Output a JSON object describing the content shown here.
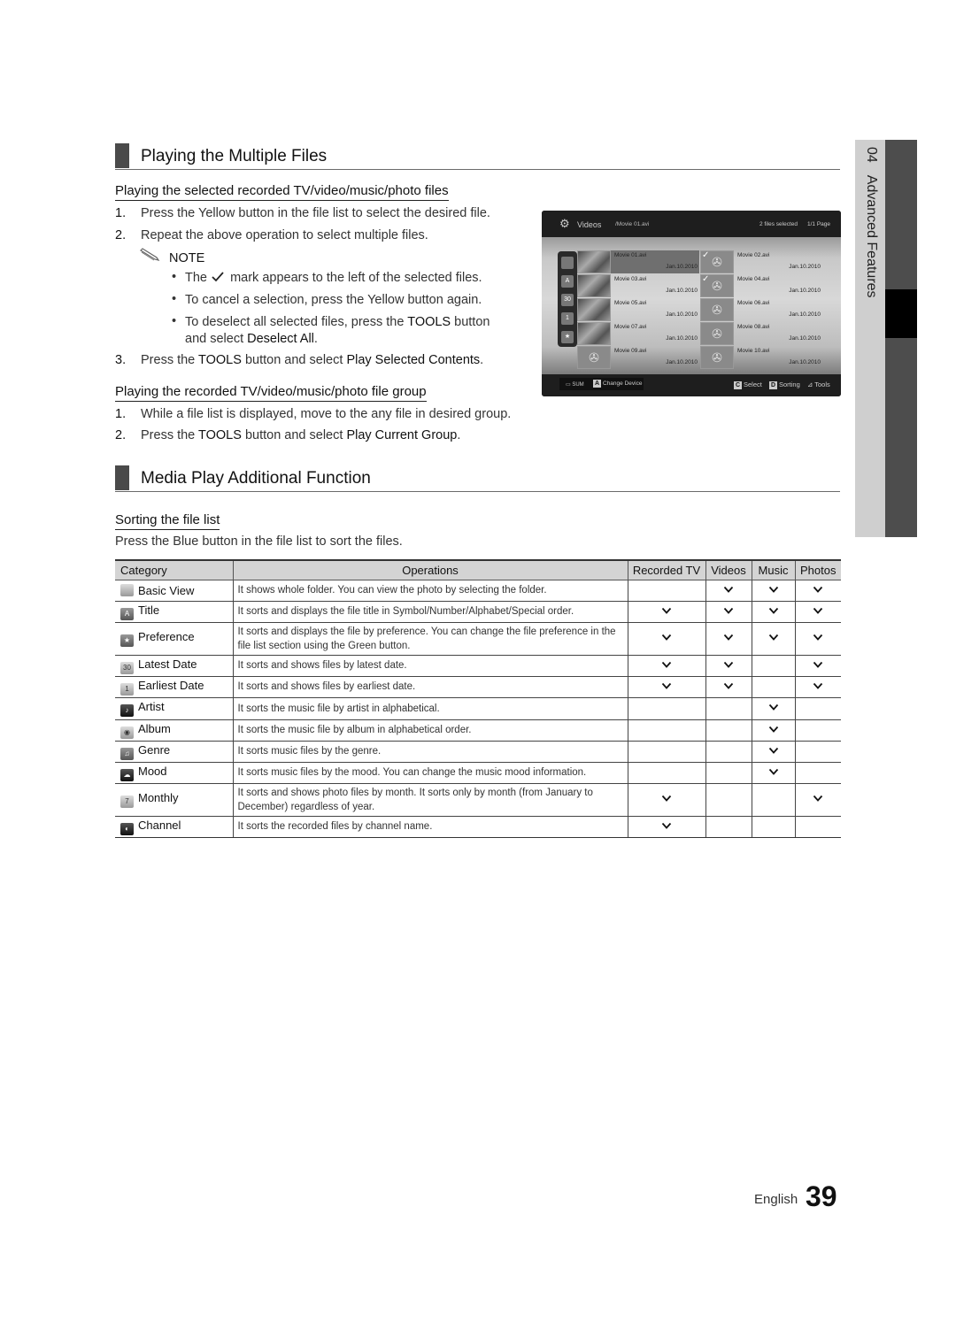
{
  "section1": {
    "title": "Playing the Multiple Files",
    "sub1": {
      "title": "Playing the selected recorded TV/video/music/photo files",
      "steps": [
        {
          "num": "1.",
          "text": "Press the Yellow button in the file list to select the desired file."
        },
        {
          "num": "2.",
          "text": "Repeat the above operation to select multiple files."
        }
      ],
      "note_label": "NOTE",
      "notes": [
        {
          "pre": "The",
          "post": "mark appears to the left of the selected files."
        },
        {
          "text": "To cancel a selection, press the Yellow button again."
        },
        {
          "pre": "To deselect all selected files, press the",
          "key": "TOOLS",
          "post": "button",
          "line2_pre": "and select",
          "line2_bold": "Deselect All",
          "line2_post": "."
        }
      ],
      "step3": {
        "num": "3.",
        "pre": "Press the",
        "key": "TOOLS",
        "mid": "button and select",
        "bold": "Play Selected Contents",
        "post": "."
      }
    },
    "sub2": {
      "title": "Playing the recorded TV/video/music/photo file group",
      "step1": {
        "num": "1.",
        "text": "While a file list is displayed, move to the any file in desired group."
      },
      "step2": {
        "num": "2.",
        "pre": "Press the",
        "key": "TOOLS",
        "mid": "button and select",
        "bold": "Play Current Group",
        "post": "."
      }
    }
  },
  "tv_screen": {
    "title": "Videos",
    "path": "/Movie 01.avi",
    "selected": "2 files selected",
    "page": "1/1 Page",
    "files": [
      {
        "name": "Movie 01.avi",
        "date": "Jan.10.2010",
        "selected": false,
        "focused": true
      },
      {
        "name": "Movie 02.avi",
        "date": "Jan.10.2010",
        "selected": true,
        "focused": false
      },
      {
        "name": "Movie 03.avi",
        "date": "Jan.10.2010",
        "selected": false,
        "focused": false
      },
      {
        "name": "Movie 04.avi",
        "date": "Jan.10.2010",
        "selected": true,
        "focused": false
      },
      {
        "name": "Movie 05.avi",
        "date": "Jan.10.2010",
        "selected": false,
        "focused": false
      },
      {
        "name": "Movie 06.avi",
        "date": "Jan.10.2010",
        "selected": false,
        "focused": false
      },
      {
        "name": "Movie 07.avi",
        "date": "Jan.10.2010",
        "selected": false,
        "focused": false
      },
      {
        "name": "Movie 08.avi",
        "date": "Jan.10.2010",
        "selected": false,
        "focused": false
      },
      {
        "name": "Movie 09.avi",
        "date": "Jan.10.2010",
        "selected": false,
        "focused": false
      },
      {
        "name": "Movie 10.avi",
        "date": "Jan.10.2010",
        "selected": false,
        "focused": false
      }
    ],
    "device": "SUM",
    "key_a": "A",
    "change_device": "Change Device",
    "key_c": "C",
    "select_label": "Select",
    "key_d": "D",
    "sorting_label": "Sorting",
    "tools_label": "Tools",
    "side_icons": [
      "folder-icon",
      "title-sort-icon",
      "latest-date-icon",
      "earliest-date-icon",
      "preference-icon"
    ],
    "side_icon_glyphs": [
      "",
      "A",
      "30",
      "1",
      "★"
    ]
  },
  "side_tab": {
    "chapter": "04",
    "label": "Advanced Features"
  },
  "section2": {
    "title": "Media Play Additional Function",
    "sub": {
      "title": "Sorting the file list",
      "desc": "Press the Blue button in the file list to sort the files."
    },
    "table": {
      "headers": [
        "Category",
        "Operations",
        "Recorded TV",
        "Videos",
        "Music",
        "Photos"
      ],
      "rows": [
        {
          "icon": "folder-icon",
          "glyph": "",
          "category": "Basic View",
          "operation": "It shows whole folder. You can view the photo by selecting the folder.",
          "marks": [
            false,
            true,
            true,
            true
          ]
        },
        {
          "icon": "title-sort-icon",
          "glyph": "A",
          "category": "Title",
          "operation": "It sorts and displays the file title in Symbol/Number/Alphabet/Special order.",
          "marks": [
            true,
            true,
            true,
            true
          ]
        },
        {
          "icon": "star-icon",
          "glyph": "★",
          "category": "Preference",
          "operation": "It sorts and displays the file by preference. You can change the file preference in the file list section using the Green button.",
          "marks": [
            true,
            true,
            true,
            true
          ]
        },
        {
          "icon": "latest-date-icon",
          "glyph": "30",
          "category": "Latest Date",
          "operation": "It sorts and shows files by latest date.",
          "marks": [
            true,
            true,
            false,
            true
          ]
        },
        {
          "icon": "earliest-date-icon",
          "glyph": "1",
          "category": "Earliest Date",
          "operation": "It sorts and shows files by earliest date.",
          "marks": [
            true,
            true,
            false,
            true
          ]
        },
        {
          "icon": "artist-icon",
          "glyph": "♪",
          "category": "Artist",
          "operation": "It sorts the music file by artist in alphabetical.",
          "marks": [
            false,
            false,
            true,
            false
          ]
        },
        {
          "icon": "album-icon",
          "glyph": "◉",
          "category": "Album",
          "operation": "It sorts the music file by album in alphabetical order.",
          "marks": [
            false,
            false,
            true,
            false
          ]
        },
        {
          "icon": "genre-icon",
          "glyph": "♫",
          "category": "Genre",
          "operation": "It sorts music files by the genre.",
          "marks": [
            false,
            false,
            true,
            false
          ]
        },
        {
          "icon": "mood-icon",
          "glyph": "☁",
          "category": "Mood",
          "operation": "It sorts music files by the mood. You can change the music mood information.",
          "marks": [
            false,
            false,
            true,
            false
          ]
        },
        {
          "icon": "monthly-icon",
          "glyph": "7",
          "category": "Monthly",
          "operation": "It sorts and shows photo files by month. It sorts only by month (from January to December) regardless of year.",
          "marks": [
            true,
            false,
            false,
            true
          ]
        },
        {
          "icon": "channel-icon",
          "glyph": "◐",
          "category": "Channel",
          "operation": "It sorts the recorded files by channel name.",
          "marks": [
            true,
            false,
            false,
            false
          ]
        }
      ]
    }
  },
  "footer": {
    "language": "English",
    "page_number": "39"
  }
}
